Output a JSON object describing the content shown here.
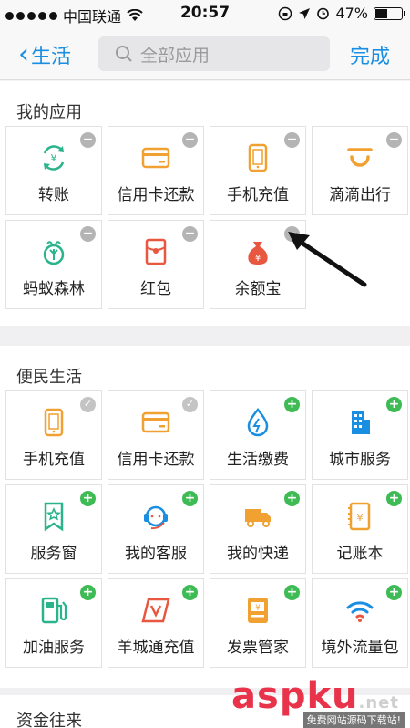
{
  "status_bar": {
    "carrier": "中国联通",
    "time": "20:57",
    "battery": "47%",
    "battery_level": 0.47
  },
  "nav": {
    "back_label": "生活",
    "search_placeholder": "全部应用",
    "done_label": "完成"
  },
  "my_apps": {
    "title": "我的应用",
    "items": [
      {
        "label": "转账",
        "icon": "transfer-icon"
      },
      {
        "label": "信用卡还款",
        "icon": "credit-card-icon"
      },
      {
        "label": "手机充值",
        "icon": "phone-topup-icon"
      },
      {
        "label": "滴滴出行",
        "icon": "didi-icon"
      },
      {
        "label": "蚂蚁森林",
        "icon": "ant-forest-icon"
      },
      {
        "label": "红包",
        "icon": "red-packet-icon"
      },
      {
        "label": "余额宝",
        "icon": "money-bag-icon"
      }
    ]
  },
  "life_services": {
    "title": "便民生活",
    "items": [
      {
        "label": "手机充值",
        "icon": "phone-topup-icon",
        "state": "added"
      },
      {
        "label": "信用卡还款",
        "icon": "credit-card-icon",
        "state": "added"
      },
      {
        "label": "生活缴费",
        "icon": "utility-icon",
        "state": "add"
      },
      {
        "label": "城市服务",
        "icon": "city-icon",
        "state": "add"
      },
      {
        "label": "服务窗",
        "icon": "service-window-icon",
        "state": "add"
      },
      {
        "label": "我的客服",
        "icon": "customer-service-icon",
        "state": "add"
      },
      {
        "label": "我的快递",
        "icon": "delivery-truck-icon",
        "state": "add"
      },
      {
        "label": "记账本",
        "icon": "ledger-icon",
        "state": "add"
      },
      {
        "label": "加油服务",
        "icon": "fuel-icon",
        "state": "add"
      },
      {
        "label": "羊城通充值",
        "icon": "yct-card-icon",
        "state": "add"
      },
      {
        "label": "发票管家",
        "icon": "invoice-icon",
        "state": "add"
      },
      {
        "label": "境外流量包",
        "icon": "wifi-icon",
        "state": "add"
      }
    ]
  },
  "next_section": {
    "title": "资金往来"
  },
  "colors": {
    "accent": "#1a8ee1",
    "add": "#3fbb55",
    "remove": "#b4b4b4",
    "orange": "#f0a132",
    "green": "#2bb48c",
    "red": "#e8573f"
  },
  "watermark": {
    "main": "aspku",
    "suffix": ".net",
    "sub": "免费网站源码下载站!"
  }
}
